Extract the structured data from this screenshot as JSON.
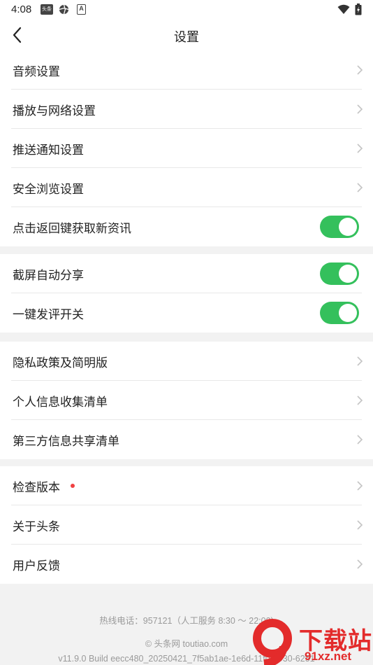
{
  "status_bar": {
    "time": "4:08",
    "news_icon_text": "头条",
    "a_icon_text": "A"
  },
  "header": {
    "title": "设置"
  },
  "groups": [
    {
      "items": [
        {
          "label": "音频设置",
          "control": "chevron"
        },
        {
          "label": "播放与网络设置",
          "control": "chevron"
        },
        {
          "label": "推送通知设置",
          "control": "chevron"
        },
        {
          "label": "安全浏览设置",
          "control": "chevron"
        },
        {
          "label": "点击返回键获取新资讯",
          "control": "toggle",
          "on": true
        }
      ]
    },
    {
      "items": [
        {
          "label": "截屏自动分享",
          "control": "toggle",
          "on": true
        },
        {
          "label": "一键发评开关",
          "control": "toggle",
          "on": true
        }
      ]
    },
    {
      "items": [
        {
          "label": "隐私政策及简明版",
          "control": "chevron"
        },
        {
          "label": "个人信息收集清单",
          "control": "chevron"
        },
        {
          "label": "第三方信息共享清单",
          "control": "chevron"
        }
      ]
    },
    {
      "items": [
        {
          "label": "检查版本",
          "control": "chevron",
          "badge": "red-dot"
        },
        {
          "label": "关于头条",
          "control": "chevron"
        },
        {
          "label": "用户反馈",
          "control": "chevron"
        }
      ]
    }
  ],
  "footer": {
    "hotline": "热线电话：957121（人工服务 8:30 ～ 22:00)",
    "copyright": "© 头条网 toutiao.com",
    "build": "v11.9.0 Build eecc480_20250421_7f5ab1ae-1e6d-11f0-8930-6251"
  },
  "watermark": {
    "text": "下载站",
    "domain": "91xz.net"
  },
  "colors": {
    "toggle_on": "#34c05c",
    "badge_red": "#f04142",
    "background": "#f2f2f2",
    "watermark_red": "#e32b2b"
  }
}
